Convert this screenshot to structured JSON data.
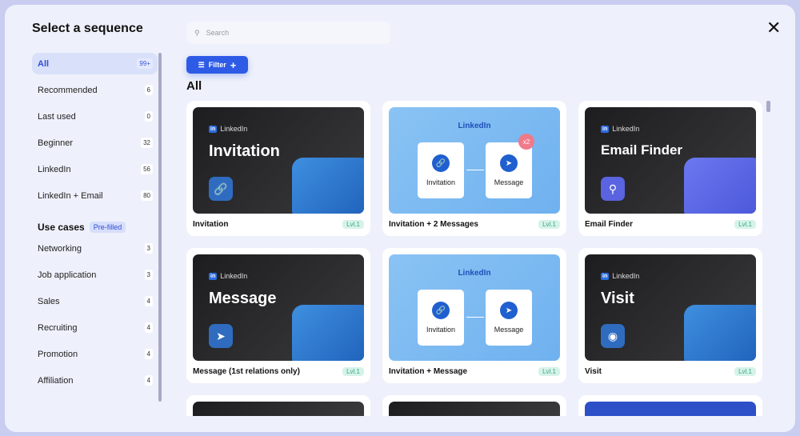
{
  "title": "Select a sequence",
  "sidebar": {
    "items": [
      {
        "label": "All",
        "count": "99+"
      },
      {
        "label": "Recommended",
        "count": "6"
      },
      {
        "label": "Last used",
        "count": "0"
      },
      {
        "label": "Beginner",
        "count": "32"
      },
      {
        "label": "LinkedIn",
        "count": "56"
      },
      {
        "label": "LinkedIn + Email",
        "count": "80"
      }
    ],
    "use_cases_label": "Use cases",
    "prefilled": "Pre-filled",
    "use_cases": [
      {
        "label": "Networking",
        "count": "3"
      },
      {
        "label": "Job application",
        "count": "3"
      },
      {
        "label": "Sales",
        "count": "4"
      },
      {
        "label": "Recruiting",
        "count": "4"
      },
      {
        "label": "Promotion",
        "count": "4"
      },
      {
        "label": "Affiliation",
        "count": "4"
      }
    ]
  },
  "search": {
    "placeholder": "Search"
  },
  "filter_label": "Filter",
  "section": "All",
  "linkedin": "LinkedIn",
  "steps": {
    "invitation": "Invitation",
    "message": "Message",
    "x2": "x2"
  },
  "cards": [
    {
      "title": "Invitation",
      "hero": "Invitation",
      "level": "Lvl.1"
    },
    {
      "title": "Invitation + 2 Messages",
      "level": "Lvl.1"
    },
    {
      "title": "Email Finder",
      "hero": "Email Finder",
      "level": "Lvl.1"
    },
    {
      "title": "Message (1st relations only)",
      "hero": "Message",
      "level": "Lvl.1"
    },
    {
      "title": "Invitation + Message",
      "level": "Lvl.1"
    },
    {
      "title": "Visit",
      "hero": "Visit",
      "level": "Lvl.1"
    }
  ]
}
